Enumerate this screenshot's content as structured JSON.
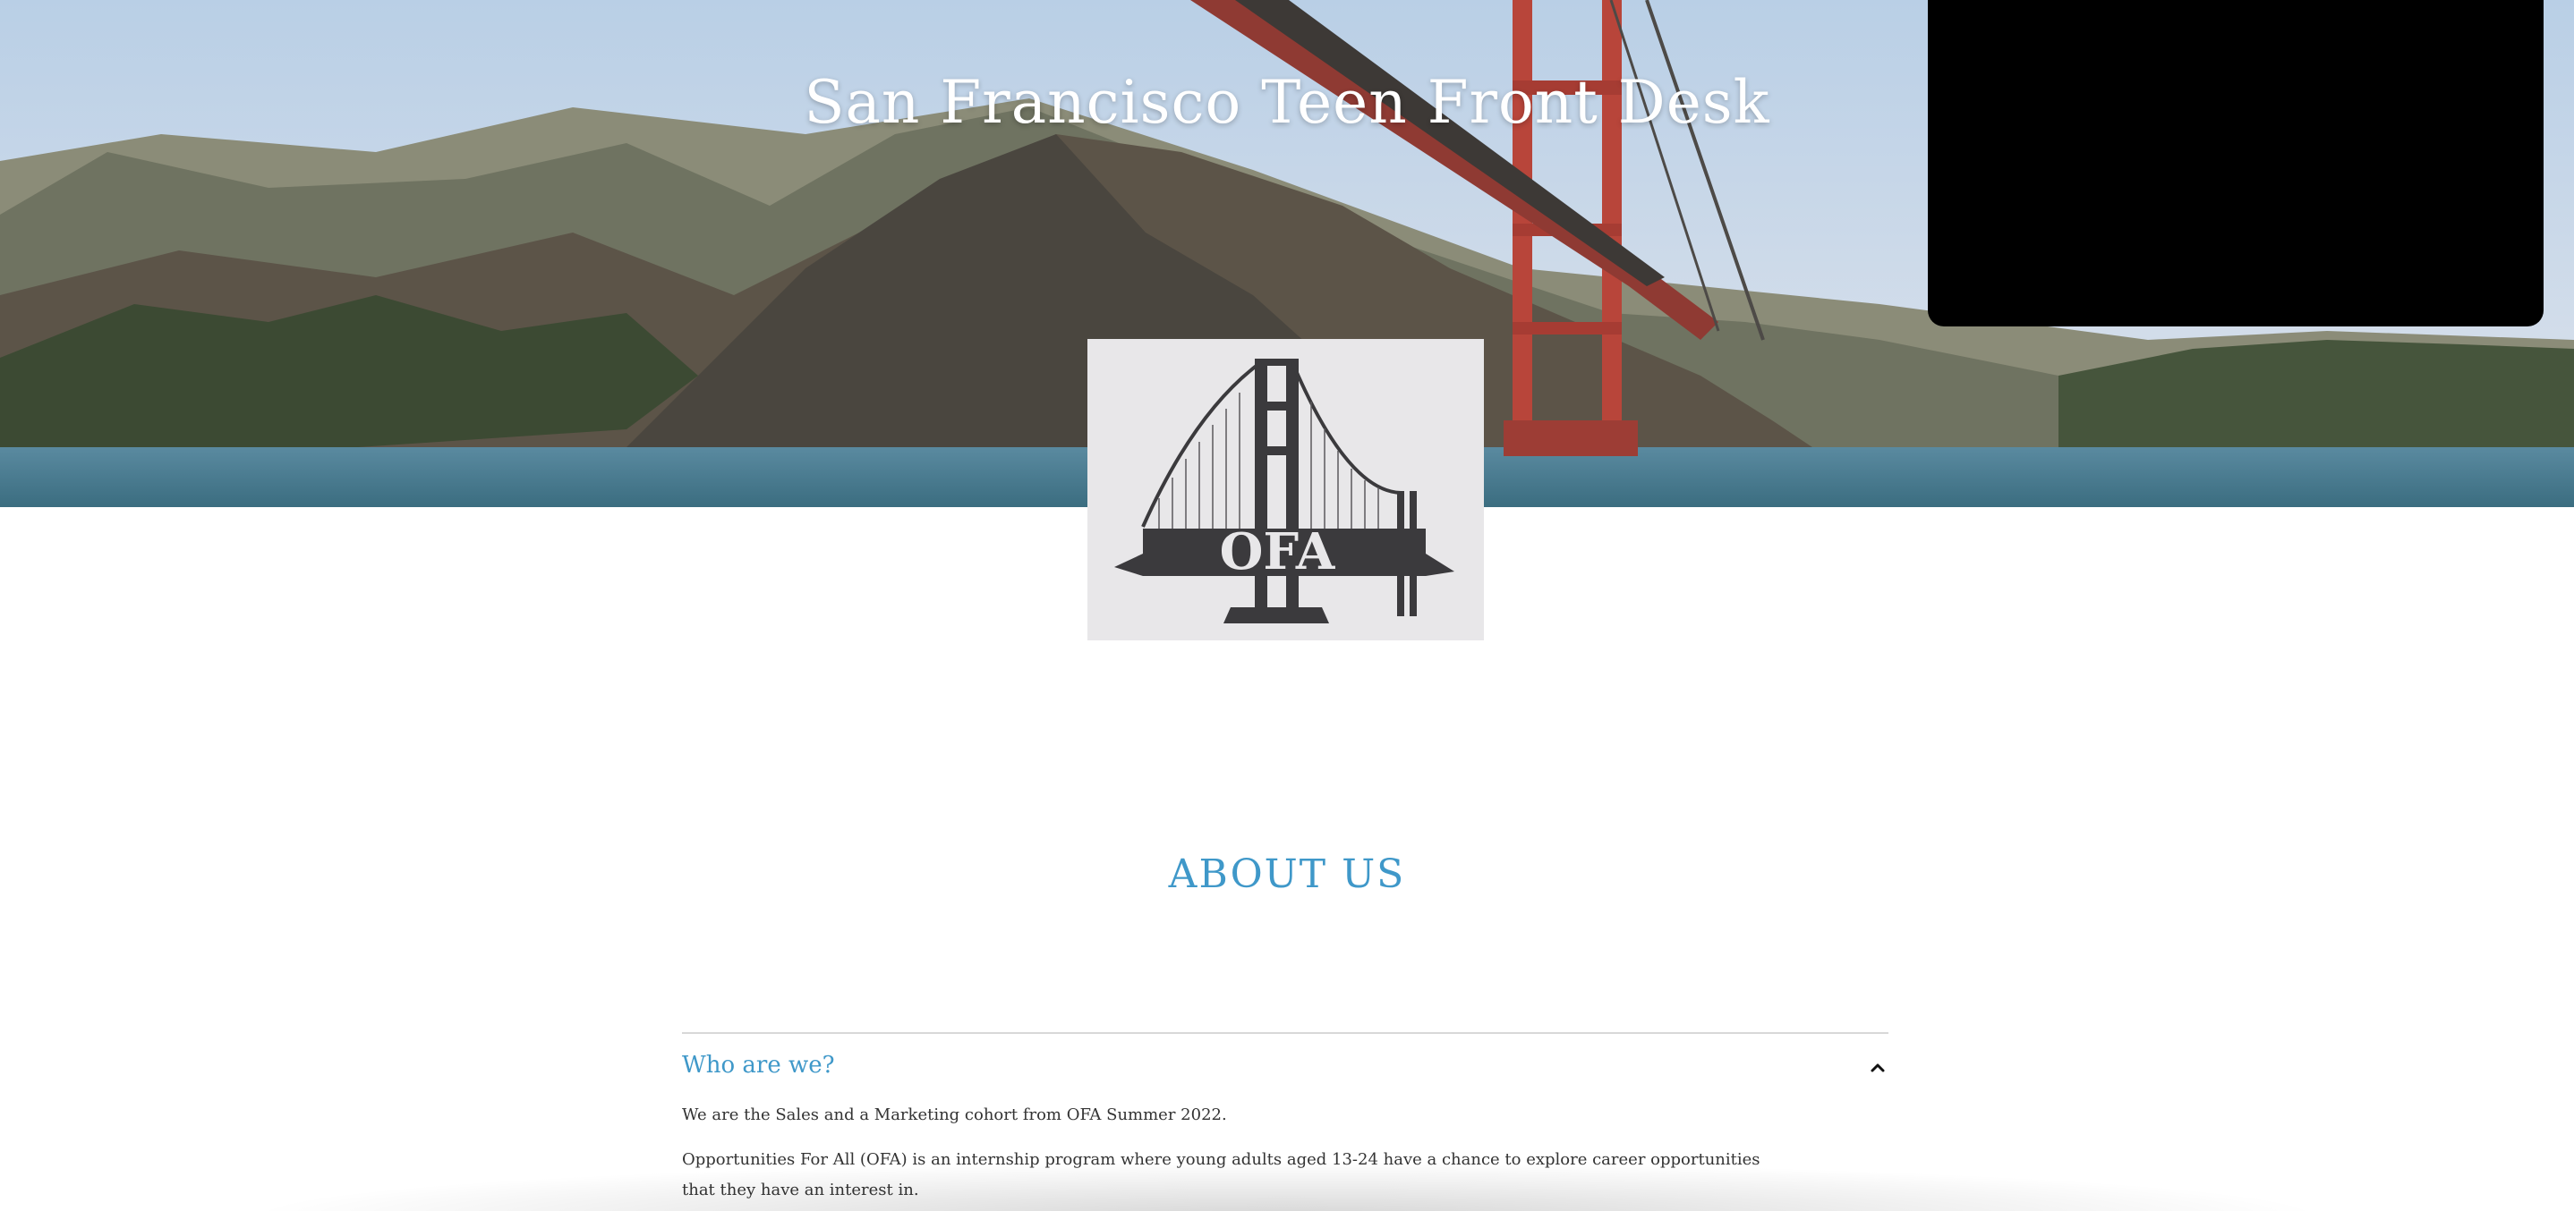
{
  "hero": {
    "title": "San Francisco Teen Front Desk"
  },
  "logo": {
    "text": "OFA",
    "alt": "OFA Golden Gate Bridge logo"
  },
  "about": {
    "heading": "ABOUT US",
    "accordion": {
      "title": "Who are we?",
      "expanded": true,
      "paragraphs": [
        "We are the Sales and a Marketing cohort from OFA Summer 2022.",
        "Opportunities For All (OFA) is an internship program where young adults aged 13-24 have a chance to explore career opportunities that they have an interest in."
      ]
    }
  },
  "colors": {
    "accent": "#3f98c9",
    "video_panel": "#000000",
    "logo_bg": "#e8e7e9",
    "bridge_red": "#b8453a"
  },
  "icons": {
    "accordion_toggle": "chevron-up-icon"
  }
}
